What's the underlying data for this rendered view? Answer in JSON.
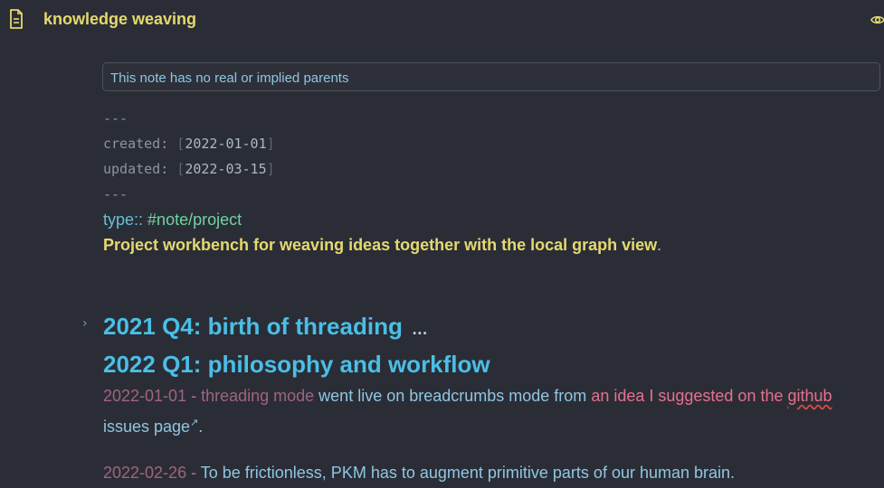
{
  "header": {
    "title": "knowledge weaving",
    "doc_icon": "document-icon",
    "view_icon": "eye-icon"
  },
  "breadcrumb": {
    "text": "This note has no real or implied parents"
  },
  "frontmatter": {
    "delimiter": "---",
    "created_key": "created:",
    "created_value": "2022-01-01",
    "updated_key": "updated:",
    "updated_value": "2022-03-15"
  },
  "property": {
    "key": "type::",
    "value": "#note/project"
  },
  "summary": {
    "text": "Project workbench for weaving ideas together with the local graph view",
    "period": "."
  },
  "sections": [
    {
      "heading": "2021 Q4: birth of threading",
      "collapsed": true,
      "ellipsis": "…"
    },
    {
      "heading": "2022 Q1: philosophy and workflow",
      "collapsed": false
    }
  ],
  "entries": [
    {
      "date": "2022-01-01",
      "dash": " - ",
      "link1": "threading mode",
      "text1": " went live on breadcrumbs mode from ",
      "link2a": "an idea I suggested on the ",
      "link2b": "github",
      "link2c": " issues page",
      "ext_icon": "external-link-icon",
      "end": "."
    },
    {
      "date": "2022-02-26",
      "dash": " - ",
      "text": "To be frictionless, PKM has to augment primitive parts of our human brain."
    }
  ],
  "colors": {
    "background": "#2b2d36",
    "title": "#e5d96e",
    "heading": "#49bfe7",
    "link": "#e6708f",
    "tag": "#6fd3a1"
  }
}
